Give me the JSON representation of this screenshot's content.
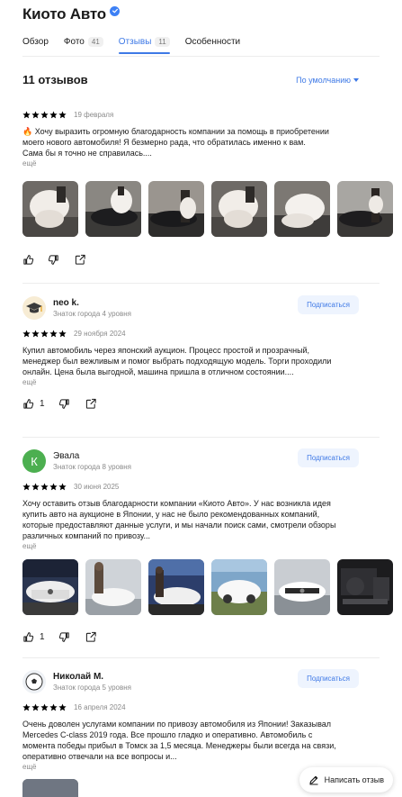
{
  "company": {
    "title": "Киото Авто",
    "verified_icon": "verified-checkmark-icon",
    "accent_color": "#3e79e6",
    "star_color": "#fc9f1d"
  },
  "tabs": [
    {
      "label": "Обзор",
      "count": ""
    },
    {
      "label": "Фото",
      "count": "41"
    },
    {
      "label": "Отзывы",
      "count": "11",
      "active": true
    },
    {
      "label": "Особенности",
      "count": ""
    }
  ],
  "summary": {
    "title": "11 отзывов",
    "sort_label": "По умолчанию"
  },
  "reviews": [
    {
      "rating": 5,
      "date": "19 февраля",
      "text": "🔥 Хочу выразить огромную благодарность компании за помощь в приобретении моего нового автомобиля! Я безмерно рада, что обратилась именно к вам.\nСама бы я точно не справилась....",
      "more": "ещё",
      "photos": 6,
      "likes": ""
    },
    {
      "author": "neo k.",
      "level": "Знаток города 4 уровня",
      "subscribe": "Подписаться",
      "rating": 5,
      "date": "29 ноября 2024",
      "text": "Купил автомобиль через японский аукцион. Процесс простой и прозрачный, менеджер был вежливым и помог выбрать подходящую модель. Торги проходили онлайн. Цена была выгодной, машина пришла в отличном состоянии....",
      "more": "ещё",
      "likes": "1"
    },
    {
      "author": "Эвала",
      "avatar_letter": "К",
      "level": "Знаток города 8 уровня",
      "subscribe": "Подписаться",
      "rating": 5,
      "date": "30 июня 2025",
      "text": "Хочу оставить отзыв благодарности компании «Киото Авто». У нас возникла идея купить авто на аукционе в Японии, у нас не было рекомендованных компаний, которые предоставляют данные услуги, и мы начали поиск сами, смотрели обзоры различных компаний по привозу...",
      "more": "ещё",
      "photos": 6,
      "likes": "1"
    },
    {
      "author": "Николай М.",
      "level": "Знаток города 5 уровня",
      "subscribe": "Подписаться",
      "rating": 5,
      "date": "16 апреля 2024",
      "text": "Очень доволен услугами компании по привозу автомобиля из Японии! Заказывал Mercedes C-class 2019 года. Все прошло гладко и оперативно. Автомобиль с момента победы прибыл в Томск за 1,5 месяца. Менеджеры были всегда на связи, оперативно отвечали на все вопросы и...",
      "more": "ещё"
    }
  ],
  "fab": {
    "label": "Написать отзыв",
    "icon": "pencil-icon"
  }
}
